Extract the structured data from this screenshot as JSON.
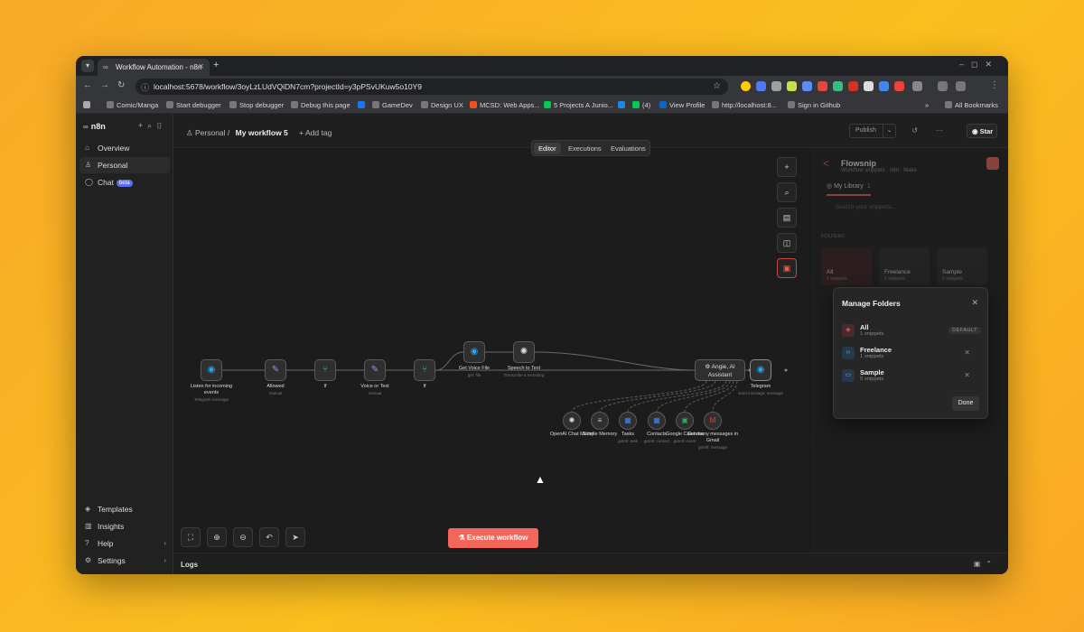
{
  "browser": {
    "tab_title": "Workflow Automation - n8n",
    "url": "localhost:5678/workflow/3oyLzLUdVQiDN7cm?projectId=y3pPSvUKuw5o10Y9",
    "bookmarks": [
      "Comic/Manga",
      "Start debugger",
      "Stop debugger",
      "Debug this page",
      "GameDev",
      "Design UX",
      "MCSD: Web Apps...",
      "5 Projects A Junio...",
      "(4)",
      "View Profile",
      "http://localhost:8...",
      "Sign in Github",
      "All Bookmarks"
    ]
  },
  "sidebar": {
    "brand": "n8n",
    "items": [
      {
        "label": "Overview"
      },
      {
        "label": "Personal"
      },
      {
        "label": "Chat",
        "badge": "beta"
      }
    ],
    "bottom_items": [
      {
        "label": "Templates"
      },
      {
        "label": "Insights"
      },
      {
        "label": "Help"
      },
      {
        "label": "Settings"
      }
    ]
  },
  "header": {
    "project": "Personal",
    "separator": "/",
    "workflow_name": "My workflow 5",
    "add_tag": "+ Add tag",
    "publish": "Publish",
    "star": "Star"
  },
  "view_tabs": [
    "Editor",
    "Executions",
    "Evaluations"
  ],
  "workflow": {
    "nodes": [
      {
        "label": "Listen for incoming events",
        "sub": "Telegram message"
      },
      {
        "label": "Allowed",
        "sub": "manual"
      },
      {
        "label": "If",
        "sub": ""
      },
      {
        "label": "Voice or Text",
        "sub": "manual"
      },
      {
        "label": "If",
        "sub": ""
      },
      {
        "label": "Get Voice File",
        "sub": "get: file"
      },
      {
        "label": "Speech to Text",
        "sub": "Transcribe a recording"
      },
      {
        "label": "Angie, AI Assistant",
        "sub": ""
      },
      {
        "label": "Telegram",
        "sub": "send message: message"
      }
    ],
    "subnodes": [
      {
        "label": "OpenAI Chat Model",
        "sub": ""
      },
      {
        "label": "Simple Memory",
        "sub": ""
      },
      {
        "label": "Tasks",
        "sub": "getAll: task"
      },
      {
        "label": "Contacts",
        "sub": "getAll: contact"
      },
      {
        "label": "Google Calendar",
        "sub": "getAll: event"
      },
      {
        "label": "Get many messages in Gmail",
        "sub": "getAll: message"
      }
    ],
    "execute_label": "Execute workflow"
  },
  "panel": {
    "title": "Flowsnip",
    "subtitle": "Workflow snippets · n8n · Make",
    "tab": "My Library",
    "tab_count": "1",
    "search_placeholder": "Search your snippets...",
    "folders_label": "FOLDERS",
    "folders": [
      {
        "name": "All",
        "count": "1 snippets"
      },
      {
        "name": "Freelance",
        "count": "1 snippets"
      },
      {
        "name": "Sample",
        "count": "0 snippets"
      }
    ]
  },
  "modal": {
    "title": "Manage Folders",
    "rows": [
      {
        "name": "All",
        "count": "1 snippets",
        "tag": "DEFAULT"
      },
      {
        "name": "Freelance",
        "count": "1 snippets"
      },
      {
        "name": "Sample",
        "count": "0 snippets"
      }
    ],
    "done": "Done"
  },
  "logs": {
    "label": "Logs"
  },
  "colors": {
    "accent": "#f4665b",
    "background": "#1c1c1c"
  }
}
